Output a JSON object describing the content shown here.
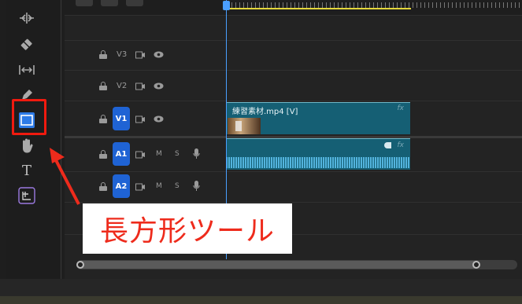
{
  "tools": {
    "items": [
      "ripple-edit-icon",
      "razor-icon",
      "slip-icon",
      "pen-icon",
      "rectangle-icon",
      "hand-icon",
      "type-icon",
      "generative-extend-icon"
    ],
    "selected": "rectangle-icon",
    "type_label": "T"
  },
  "tracks": {
    "video": [
      {
        "name": "V3",
        "targeted": false
      },
      {
        "name": "V2",
        "targeted": false
      },
      {
        "name": "V1",
        "targeted": true
      }
    ],
    "audio": [
      {
        "name": "A1",
        "targeted": true,
        "mute": "M",
        "solo": "S"
      },
      {
        "name": "A2",
        "targeted": true,
        "mute": "M",
        "solo": "S"
      }
    ]
  },
  "clips": {
    "video": {
      "title": "練習素材.mp4 [V]",
      "fx": "fx"
    },
    "audio": {
      "fx": "fx"
    }
  },
  "annotation": {
    "callout_text": "長方形ツール",
    "color": "#ee2b1c"
  },
  "colors": {
    "clip": "#155f74",
    "target": "#1f63d4",
    "playhead": "#4a9fff",
    "work_area": "#e3d63b"
  }
}
